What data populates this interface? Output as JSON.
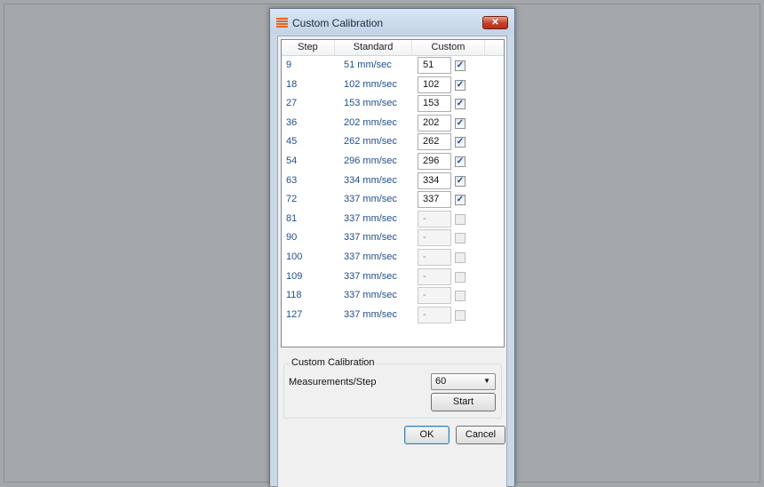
{
  "window": {
    "title": "Custom Calibration",
    "close_label": "✕"
  },
  "list": {
    "columns": [
      "Step",
      "Standard",
      "Custom"
    ],
    "rows": [
      {
        "step": "9",
        "standard": "51 mm/sec",
        "custom": "51",
        "checked": true
      },
      {
        "step": "18",
        "standard": "102 mm/sec",
        "custom": "102",
        "checked": true
      },
      {
        "step": "27",
        "standard": "153 mm/sec",
        "custom": "153",
        "checked": true
      },
      {
        "step": "36",
        "standard": "202 mm/sec",
        "custom": "202",
        "checked": true
      },
      {
        "step": "45",
        "standard": "262 mm/sec",
        "custom": "262",
        "checked": true
      },
      {
        "step": "54",
        "standard": "296 mm/sec",
        "custom": "296",
        "checked": true
      },
      {
        "step": "63",
        "standard": "334 mm/sec",
        "custom": "334",
        "checked": true
      },
      {
        "step": "72",
        "standard": "337 mm/sec",
        "custom": "337",
        "checked": true
      },
      {
        "step": "81",
        "standard": "337 mm/sec",
        "custom": "-",
        "checked": false
      },
      {
        "step": "90",
        "standard": "337 mm/sec",
        "custom": "-",
        "checked": false
      },
      {
        "step": "100",
        "standard": "337 mm/sec",
        "custom": "-",
        "checked": false
      },
      {
        "step": "109",
        "standard": "337 mm/sec",
        "custom": "-",
        "checked": false
      },
      {
        "step": "118",
        "standard": "337 mm/sec",
        "custom": "-",
        "checked": false
      },
      {
        "step": "127",
        "standard": "337 mm/sec",
        "custom": "-",
        "checked": false
      }
    ]
  },
  "calibration": {
    "group_label": "Custom Calibration",
    "measurements_label": "Measurements/Step",
    "measurements_value": "60",
    "start_label": "Start"
  },
  "footer": {
    "ok_label": "OK",
    "cancel_label": "Cancel"
  },
  "colors": {
    "accent_text": "#1f4e8c",
    "close_button": "#c4402b",
    "icon": "#e8641f"
  }
}
